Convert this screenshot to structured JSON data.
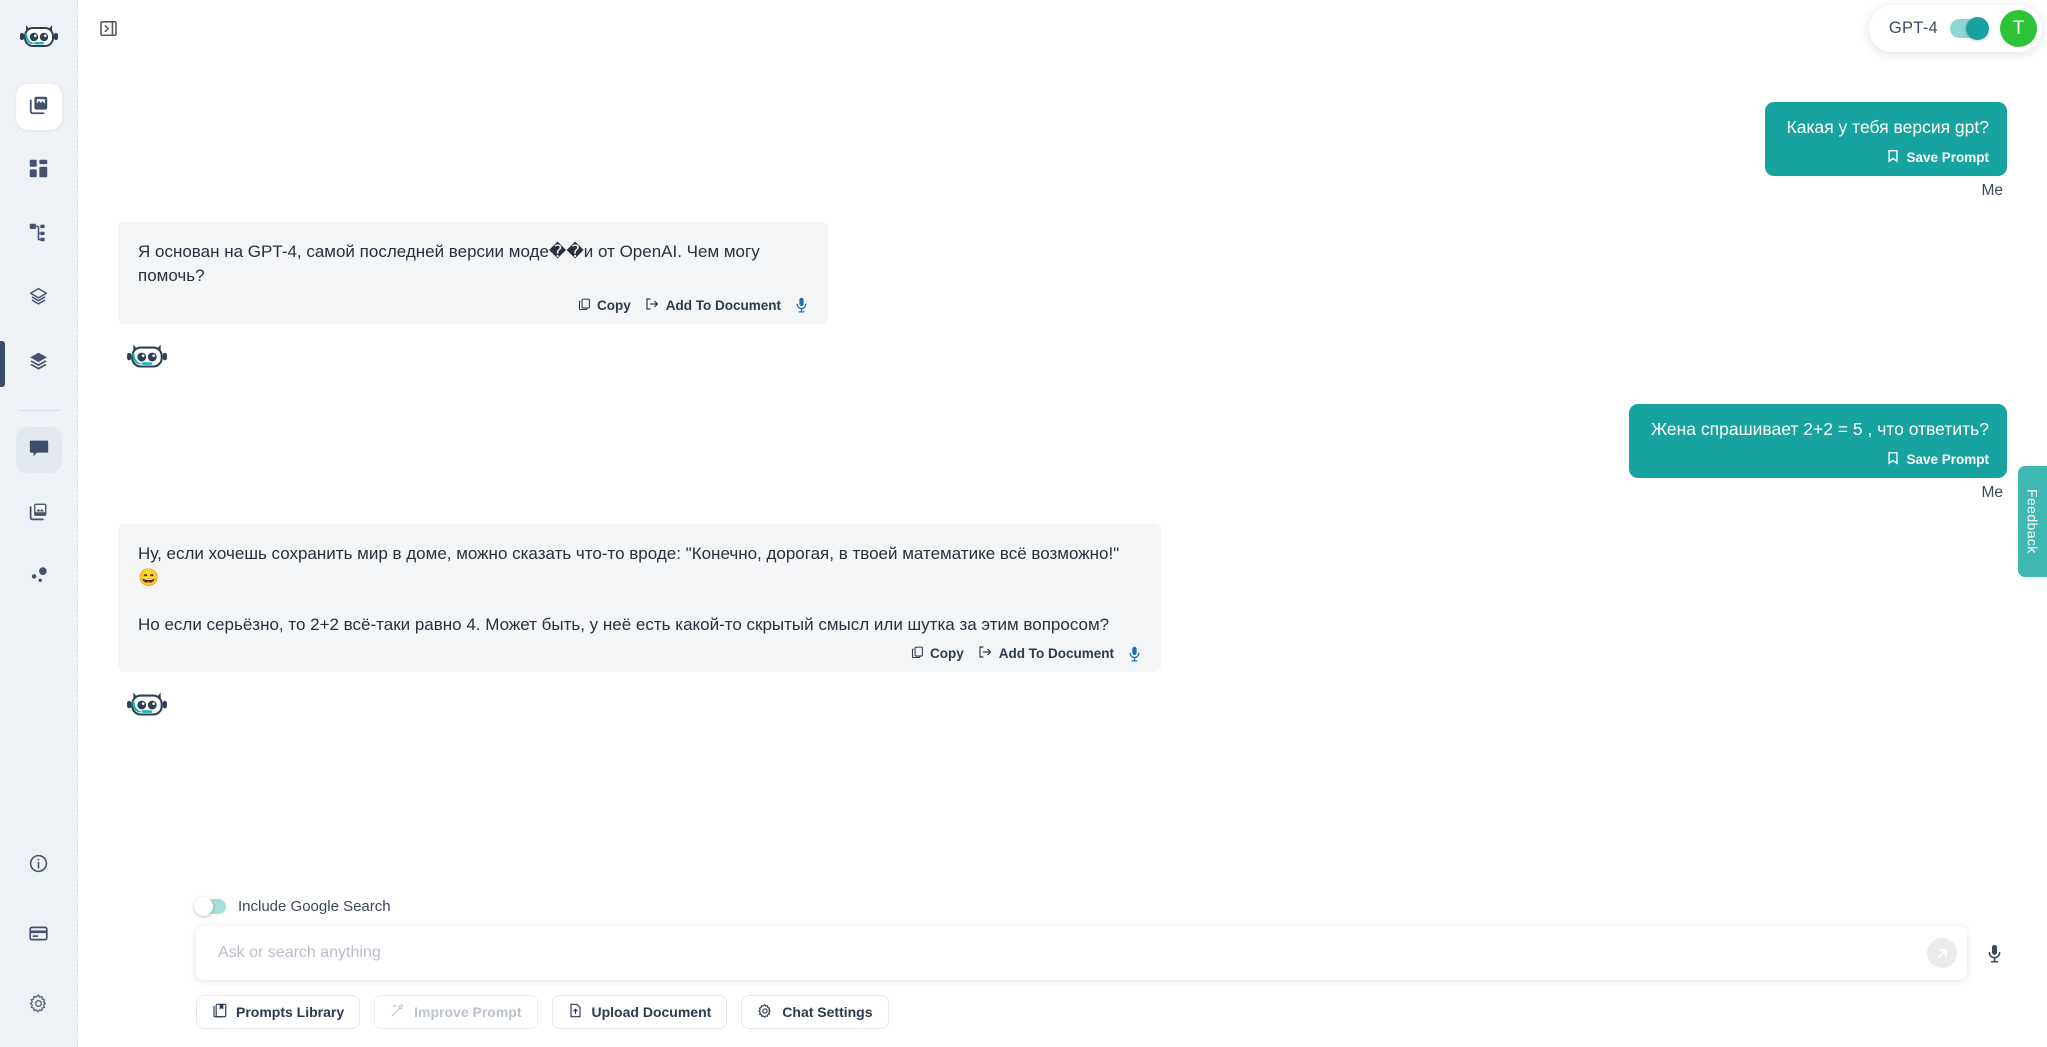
{
  "app": {
    "logo_icon": "robot-logo-icon",
    "panel_toggle_icon": "panel-expand-icon"
  },
  "sidebar": {
    "items": [
      {
        "label": "Gallery",
        "icon": "images-stack-icon",
        "state": "active-white"
      },
      {
        "label": "Dashboard",
        "icon": "dashboard-grid-icon",
        "state": ""
      },
      {
        "label": "Workflows",
        "icon": "sitemap-icon",
        "state": ""
      },
      {
        "label": "Layers Outline",
        "icon": "layers-outline-icon",
        "state": ""
      },
      {
        "label": "Layers Filled",
        "icon": "layers-filled-icon",
        "state": ""
      }
    ],
    "group_two": [
      {
        "label": "Chat",
        "icon": "chat-bubble-icon",
        "state": "active-grey"
      },
      {
        "label": "Images",
        "icon": "images-stack-icon",
        "state": ""
      },
      {
        "label": "Connections",
        "icon": "nodes-icon",
        "state": ""
      }
    ],
    "bottom_items": [
      {
        "label": "Info",
        "icon": "info-circle-icon"
      },
      {
        "label": "Billing",
        "icon": "credit-card-icon"
      },
      {
        "label": "Settings",
        "icon": "gear-icon"
      }
    ]
  },
  "header": {
    "model_label": "GPT-4",
    "model_toggle_on": true,
    "avatar_initial": "T",
    "avatar_color": "#2cc336",
    "accent_color": "#17a3a0"
  },
  "feedback": {
    "label": "Feedback"
  },
  "chat": {
    "sender_label": "Me",
    "save_prompt_label": "Save Prompt",
    "copy_label": "Copy",
    "add_to_document_label": "Add To Document",
    "messages": [
      {
        "role": "user",
        "text": "Какая у тебя версия gpt?"
      },
      {
        "role": "assistant",
        "paragraphs": [
          "Я основан на GPT-4, самой последней версии моде��и от OpenAI. Чем могу помочь?"
        ]
      },
      {
        "role": "user",
        "text": "Жена спрашивает 2+2 = 5 , что ответить?"
      },
      {
        "role": "assistant",
        "paragraphs": [
          "Ну, если хочешь сохранить мир в доме, можно сказать что-то вроде: \"Конечно, дорогая, в твоей математике всё возможно!\" 😄",
          "Но если серьёзно, то 2+2 всё-таки равно 4. Может быть, у неё есть какой-то скрытый смысл или шутка за этим вопросом?"
        ]
      }
    ]
  },
  "composer": {
    "google_search_label": "Include Google Search",
    "google_search_on": false,
    "input_value": "",
    "input_placeholder": "Ask or search anything",
    "send_icon": "send-arrow-icon",
    "mic_icon": "microphone-icon",
    "tools": [
      {
        "label": "Prompts Library",
        "icon": "book-icon",
        "disabled": false
      },
      {
        "label": "Improve Prompt",
        "icon": "magic-wand-icon",
        "disabled": true
      },
      {
        "label": "Upload Document",
        "icon": "upload-file-icon",
        "disabled": false
      },
      {
        "label": "Chat Settings",
        "icon": "gear-icon",
        "disabled": false
      }
    ]
  }
}
